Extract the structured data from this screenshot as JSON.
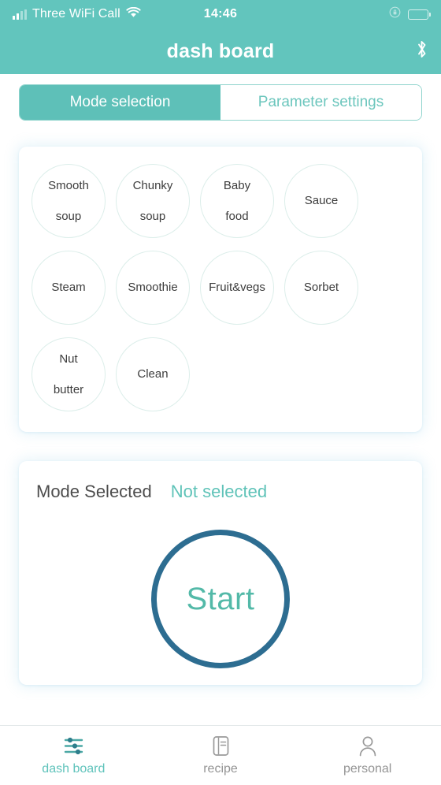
{
  "status_bar": {
    "carrier": "Three WiFi Call",
    "time": "14:46",
    "signal_icon": "cellular-signal-icon",
    "wifi_icon": "wifi-icon",
    "rotation_lock_icon": "rotation-lock-icon",
    "battery_icon": "battery-icon"
  },
  "header": {
    "title": "dash board",
    "bluetooth_icon": "bluetooth-icon"
  },
  "tabs": [
    {
      "label": "Mode selection",
      "active": true
    },
    {
      "label": "Parameter settings",
      "active": false
    }
  ],
  "modes": [
    {
      "label": "Smooth\nsoup",
      "line1": "Smooth",
      "line2": "soup"
    },
    {
      "label": "Chunky\nsoup",
      "line1": "Chunky",
      "line2": "soup"
    },
    {
      "label": "Baby\nfood",
      "line1": "Baby",
      "line2": "food"
    },
    {
      "label": "Sauce",
      "line1": "Sauce",
      "line2": ""
    },
    {
      "label": "Steam",
      "line1": "Steam",
      "line2": ""
    },
    {
      "label": "Smoothie",
      "line1": "Smoothie",
      "line2": ""
    },
    {
      "label": "Fruit&vegs",
      "line1": "Fruit&vegs",
      "line2": ""
    },
    {
      "label": "Sorbet",
      "line1": "Sorbet",
      "line2": ""
    },
    {
      "label": "Nut\nbutter",
      "line1": "Nut",
      "line2": "butter"
    },
    {
      "label": "Clean",
      "line1": "Clean",
      "line2": ""
    }
  ],
  "status_panel": {
    "mode_selected_label": "Mode Selected",
    "mode_selected_value": "Not selected",
    "start_label": "Start"
  },
  "bottom_nav": [
    {
      "label": "dash board",
      "icon": "sliders-icon",
      "active": true
    },
    {
      "label": "recipe",
      "icon": "notebook-icon",
      "active": false
    },
    {
      "label": "personal",
      "icon": "person-icon",
      "active": false
    }
  ],
  "colors": {
    "brand_teal": "#62c5bd",
    "tab_active_bg": "#5ec0b8",
    "accent_text": "#5fc3b8",
    "start_ring": "#2d6d91",
    "start_text": "#53b9a8",
    "circle_border": "#dceeea",
    "inactive_nav": "#949494"
  }
}
